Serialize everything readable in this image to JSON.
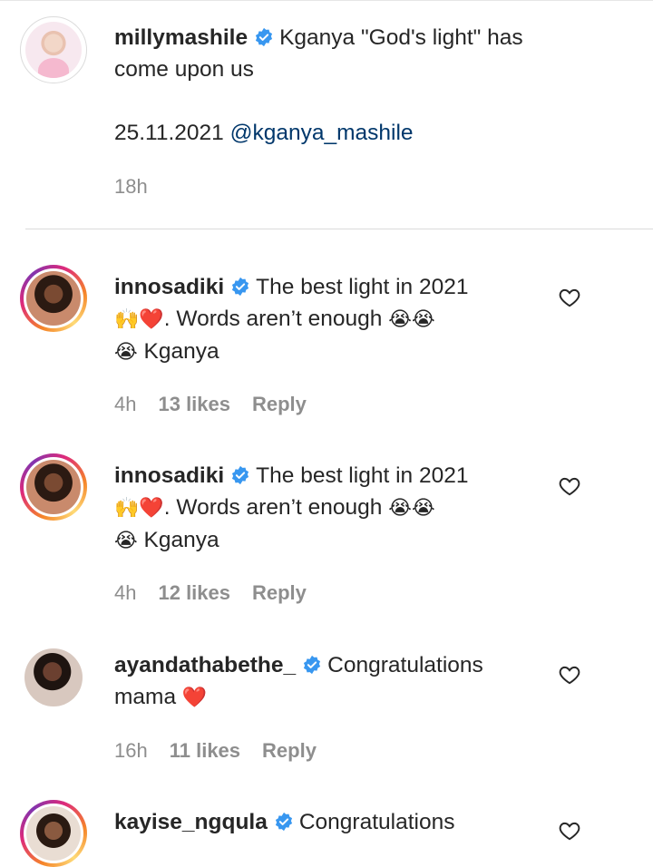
{
  "caption": {
    "username": "millymashile",
    "text_line1": "Kganya \"God's light\" has",
    "text_line2": "come upon us",
    "date": "25.11.2021",
    "mention": "@kganya_mashile",
    "time": "18h"
  },
  "comments": [
    {
      "username": "innosadiki",
      "line1": "The best light in 2021",
      "emoji_line2_a": "🙌❤️",
      "line2": ". Words aren’t enough",
      "emoji_line2_b": "😭😭",
      "emoji_line3": "😭",
      "line3": "Kganya",
      "time": "4h",
      "likes": "13 likes",
      "reply": "Reply"
    },
    {
      "username": "innosadiki",
      "line1": "The best light in 2021",
      "emoji_line2_a": "🙌❤️",
      "line2": ". Words aren’t enough",
      "emoji_line2_b": "😭😭",
      "emoji_line3": "😭",
      "line3": "Kganya",
      "time": "4h",
      "likes": "12 likes",
      "reply": "Reply"
    },
    {
      "username": "ayandathabethe_",
      "line1": "Congratulations",
      "line2": "mama",
      "emoji_line2": "❤️",
      "time": "16h",
      "likes": "11 likes",
      "reply": "Reply"
    },
    {
      "username": "kayise_ngqula",
      "line1": "Congratulations"
    }
  ],
  "icons": {
    "verified": "verified-badge-icon",
    "like": "heart-outline-icon"
  },
  "colors": {
    "text": "#262626",
    "meta": "#8e8e8e",
    "mention": "#00376b",
    "verified": "#3897f0"
  }
}
